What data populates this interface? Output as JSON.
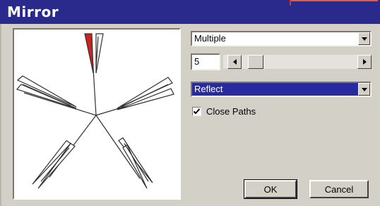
{
  "window": {
    "title": "Mirror"
  },
  "mode_select": {
    "value": "Multiple"
  },
  "count": {
    "value": "5",
    "slider_fraction": 0.05
  },
  "operation_select": {
    "value": "Reflect"
  },
  "close_paths": {
    "label": "Close Paths",
    "checked": true
  },
  "buttons": {
    "ok": "OK",
    "cancel": "Cancel"
  },
  "colors": {
    "title_bar": "#2a2a8c",
    "selection": "#2a2aa0",
    "highlight_shape": "#d02020",
    "accent_line": "#e05a3c"
  },
  "icons": {
    "dropdown": "chevron-down-icon",
    "scroll_left": "arrow-left-icon",
    "scroll_right": "arrow-right-icon",
    "check": "checkmark-icon"
  }
}
